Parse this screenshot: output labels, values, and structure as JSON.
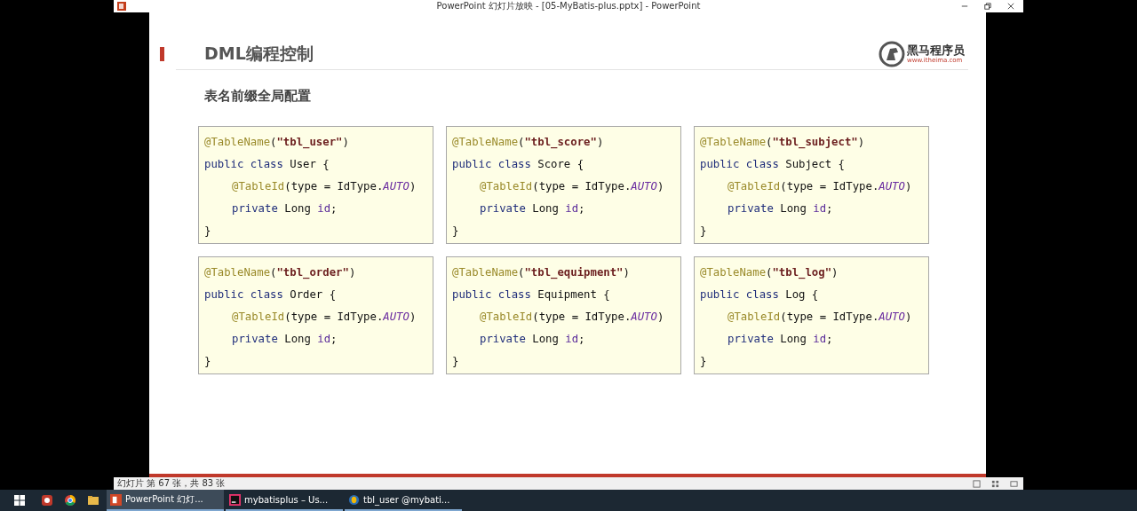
{
  "window": {
    "title": "PowerPoint 幻灯片放映 - [05-MyBatis-plus.pptx] - PowerPoint"
  },
  "slide": {
    "title": "DML编程控制",
    "logo": {
      "name": "黑马程序员",
      "url": "www.itheima.com"
    },
    "subtitle": "表名前缀全局配置",
    "code_blocks": [
      {
        "lines": [
          {
            "parts": [
              {
                "kind": "ann",
                "text": "@TableName"
              },
              {
                "kind": "plain",
                "text": "("
              },
              {
                "kind": "str",
                "text": "\"tbl_user\""
              },
              {
                "kind": "plain",
                "text": ")"
              }
            ]
          },
          {
            "parts": [
              {
                "kind": "kw",
                "text": "public class"
              },
              {
                "kind": "plain",
                "text": " User {"
              }
            ],
            "children": [
              {
                "parts": [
                  {
                    "kind": "ann",
                    "text": "@TableId"
                  },
                  {
                    "kind": "plain",
                    "text": "(type = IdType."
                  },
                  {
                    "kind": "const",
                    "text": "AUTO"
                  },
                  {
                    "kind": "plain",
                    "text": ")"
                  }
                ]
              },
              {
                "parts": [
                  {
                    "kind": "kw",
                    "text": "private"
                  },
                  {
                    "kind": "plain",
                    "text": " Long "
                  },
                  {
                    "kind": "field",
                    "text": "id"
                  },
                  {
                    "kind": "plain",
                    "text": ";"
                  }
                ]
              }
            ]
          },
          {
            "parts": [
              {
                "kind": "plain",
                "text": "}"
              }
            ]
          }
        ]
      },
      {
        "lines": [
          {
            "parts": [
              {
                "kind": "ann",
                "text": "@TableName"
              },
              {
                "kind": "plain",
                "text": "("
              },
              {
                "kind": "str",
                "text": "\"tbl_score\""
              },
              {
                "kind": "plain",
                "text": ")"
              }
            ]
          },
          {
            "parts": [
              {
                "kind": "kw",
                "text": "public class"
              },
              {
                "kind": "plain",
                "text": " Score {"
              }
            ],
            "children": [
              {
                "parts": [
                  {
                    "kind": "ann",
                    "text": "@TableId"
                  },
                  {
                    "kind": "plain",
                    "text": "(type = IdType."
                  },
                  {
                    "kind": "const",
                    "text": "AUTO"
                  },
                  {
                    "kind": "plain",
                    "text": ")"
                  }
                ]
              },
              {
                "parts": [
                  {
                    "kind": "kw",
                    "text": "private"
                  },
                  {
                    "kind": "plain",
                    "text": " Long "
                  },
                  {
                    "kind": "field",
                    "text": "id"
                  },
                  {
                    "kind": "plain",
                    "text": ";"
                  }
                ]
              }
            ]
          },
          {
            "parts": [
              {
                "kind": "plain",
                "text": "}"
              }
            ]
          }
        ]
      },
      {
        "lines": [
          {
            "parts": [
              {
                "kind": "ann",
                "text": "@TableName"
              },
              {
                "kind": "plain",
                "text": "("
              },
              {
                "kind": "str",
                "text": "\"tbl_subject\""
              },
              {
                "kind": "plain",
                "text": ")"
              }
            ]
          },
          {
            "parts": [
              {
                "kind": "kw",
                "text": "public class"
              },
              {
                "kind": "plain",
                "text": " Subject {"
              }
            ],
            "children": [
              {
                "parts": [
                  {
                    "kind": "ann",
                    "text": "@TableId"
                  },
                  {
                    "kind": "plain",
                    "text": "(type = IdType."
                  },
                  {
                    "kind": "const",
                    "text": "AUTO"
                  },
                  {
                    "kind": "plain",
                    "text": ")"
                  }
                ]
              },
              {
                "parts": [
                  {
                    "kind": "kw",
                    "text": "private"
                  },
                  {
                    "kind": "plain",
                    "text": " Long "
                  },
                  {
                    "kind": "field",
                    "text": "id"
                  },
                  {
                    "kind": "plain",
                    "text": ";"
                  }
                ]
              }
            ]
          },
          {
            "parts": [
              {
                "kind": "plain",
                "text": "}"
              }
            ]
          }
        ]
      },
      {
        "lines": [
          {
            "parts": [
              {
                "kind": "ann",
                "text": "@TableName"
              },
              {
                "kind": "plain",
                "text": "("
              },
              {
                "kind": "str",
                "text": "\"tbl_order\""
              },
              {
                "kind": "plain",
                "text": ")"
              }
            ]
          },
          {
            "parts": [
              {
                "kind": "kw",
                "text": "public class"
              },
              {
                "kind": "plain",
                "text": " Order {"
              }
            ],
            "children": [
              {
                "parts": [
                  {
                    "kind": "ann",
                    "text": "@TableId"
                  },
                  {
                    "kind": "plain",
                    "text": "(type = IdType."
                  },
                  {
                    "kind": "const",
                    "text": "AUTO"
                  },
                  {
                    "kind": "plain",
                    "text": ")"
                  }
                ]
              },
              {
                "parts": [
                  {
                    "kind": "kw",
                    "text": "private"
                  },
                  {
                    "kind": "plain",
                    "text": " Long "
                  },
                  {
                    "kind": "field",
                    "text": "id"
                  },
                  {
                    "kind": "plain",
                    "text": ";"
                  }
                ]
              }
            ]
          },
          {
            "parts": [
              {
                "kind": "plain",
                "text": "}"
              }
            ]
          }
        ]
      },
      {
        "lines": [
          {
            "parts": [
              {
                "kind": "ann",
                "text": "@TableName"
              },
              {
                "kind": "plain",
                "text": "("
              },
              {
                "kind": "str",
                "text": "\"tbl_equipment\""
              },
              {
                "kind": "plain",
                "text": ")"
              }
            ]
          },
          {
            "parts": [
              {
                "kind": "kw",
                "text": "public class"
              },
              {
                "kind": "plain",
                "text": " Equipment {"
              }
            ],
            "children": [
              {
                "parts": [
                  {
                    "kind": "ann",
                    "text": "@TableId"
                  },
                  {
                    "kind": "plain",
                    "text": "(type = IdType."
                  },
                  {
                    "kind": "const",
                    "text": "AUTO"
                  },
                  {
                    "kind": "plain",
                    "text": ")"
                  }
                ]
              },
              {
                "parts": [
                  {
                    "kind": "kw",
                    "text": "private"
                  },
                  {
                    "kind": "plain",
                    "text": " Long "
                  },
                  {
                    "kind": "field",
                    "text": "id"
                  },
                  {
                    "kind": "plain",
                    "text": ";"
                  }
                ]
              }
            ]
          },
          {
            "parts": [
              {
                "kind": "plain",
                "text": "}"
              }
            ]
          }
        ]
      },
      {
        "lines": [
          {
            "parts": [
              {
                "kind": "ann",
                "text": "@TableName"
              },
              {
                "kind": "plain",
                "text": "("
              },
              {
                "kind": "str",
                "text": "\"tbl_log\""
              },
              {
                "kind": "plain",
                "text": ")"
              }
            ]
          },
          {
            "parts": [
              {
                "kind": "kw",
                "text": "public class"
              },
              {
                "kind": "plain",
                "text": " Log {"
              }
            ],
            "children": [
              {
                "parts": [
                  {
                    "kind": "ann",
                    "text": "@TableId"
                  },
                  {
                    "kind": "plain",
                    "text": "(type = IdType."
                  },
                  {
                    "kind": "const",
                    "text": "AUTO"
                  },
                  {
                    "kind": "plain",
                    "text": ")"
                  }
                ]
              },
              {
                "parts": [
                  {
                    "kind": "kw",
                    "text": "private"
                  },
                  {
                    "kind": "plain",
                    "text": " Long "
                  },
                  {
                    "kind": "field",
                    "text": "id"
                  },
                  {
                    "kind": "plain",
                    "text": ";"
                  }
                ]
              }
            ]
          },
          {
            "parts": [
              {
                "kind": "plain",
                "text": "}"
              }
            ]
          }
        ]
      }
    ]
  },
  "status_bar": {
    "slide_counter": "幻灯片 第 67 张，共 83 张"
  },
  "taskbar": {
    "apps": [
      {
        "kind": "powerpoint",
        "label": "PowerPoint 幻灯...",
        "selected": true
      },
      {
        "kind": "idea",
        "label": "mybatisplus – Us...",
        "selected": false
      },
      {
        "kind": "database",
        "label": "tbl_user @mybati...",
        "selected": false
      }
    ]
  }
}
